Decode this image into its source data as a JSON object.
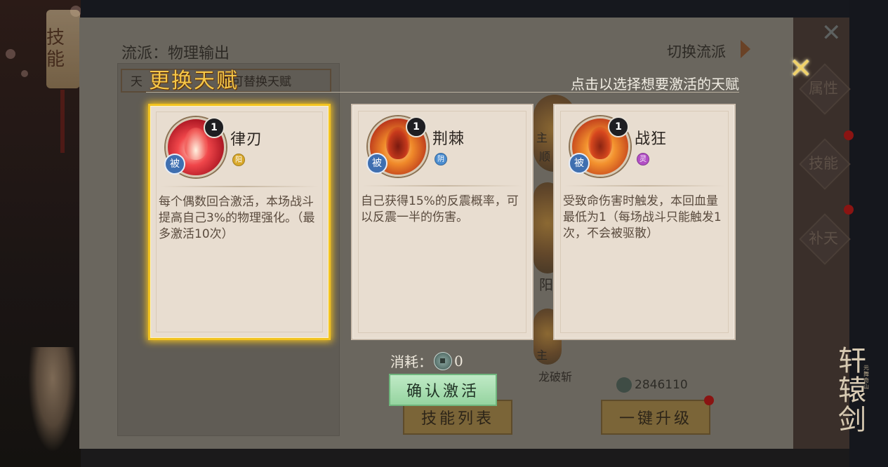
{
  "background": {
    "left_tab_label": "技能",
    "school_label": "流派：物理输出",
    "switch_school_label": "切换流派",
    "hint_box": {
      "left": "天",
      "right": "击可替换天赋"
    },
    "side_tabs": [
      "属性",
      "技能",
      "补天"
    ],
    "bg_words": {
      "zhu_1": "主",
      "shun": "顺",
      "yang": "阳",
      "zhu_2": "主",
      "longpozhan": "龙破斩"
    },
    "buttons": {
      "skill_list": "技能列表",
      "one_key_upgrade": "一键升级"
    },
    "currency_amount": "2846110",
    "logo": {
      "title": "轩辕剑",
      "subtitle": "元舞奇山"
    }
  },
  "dialog": {
    "title": "更换天赋",
    "hint": "点击以选择想要激活的天赋",
    "cards": [
      {
        "name": "律刃",
        "level": "1",
        "passive": "被",
        "element": "阳",
        "element_color": "#d9a82a",
        "icon_color": "#c8232e",
        "selected": true,
        "description": "每个偶数回合激活，本场战斗提高自己3%的物理强化。（最多激活10次）"
      },
      {
        "name": "荆棘",
        "level": "1",
        "passive": "被",
        "element": "阴",
        "element_color": "#4a8ccf",
        "icon_color": "#d2561a",
        "selected": false,
        "description": "自己获得15%的反震概率，可以反震一半的伤害。"
      },
      {
        "name": "战狂",
        "level": "1",
        "passive": "被",
        "element": "灵",
        "element_color": "#b24fc4",
        "icon_color": "#d5541c",
        "selected": false,
        "description": "受致命伤害时触发，本回血量最低为1（每场战斗只能触发1次，不会被驱散）"
      }
    ],
    "cost_label": "消耗：",
    "cost_value": "0",
    "confirm_button": "确认激活"
  },
  "colors": {
    "selected_border": "#f2c320",
    "title_gold": "#f5c84a",
    "confirm_green": "#a8dfb0"
  }
}
